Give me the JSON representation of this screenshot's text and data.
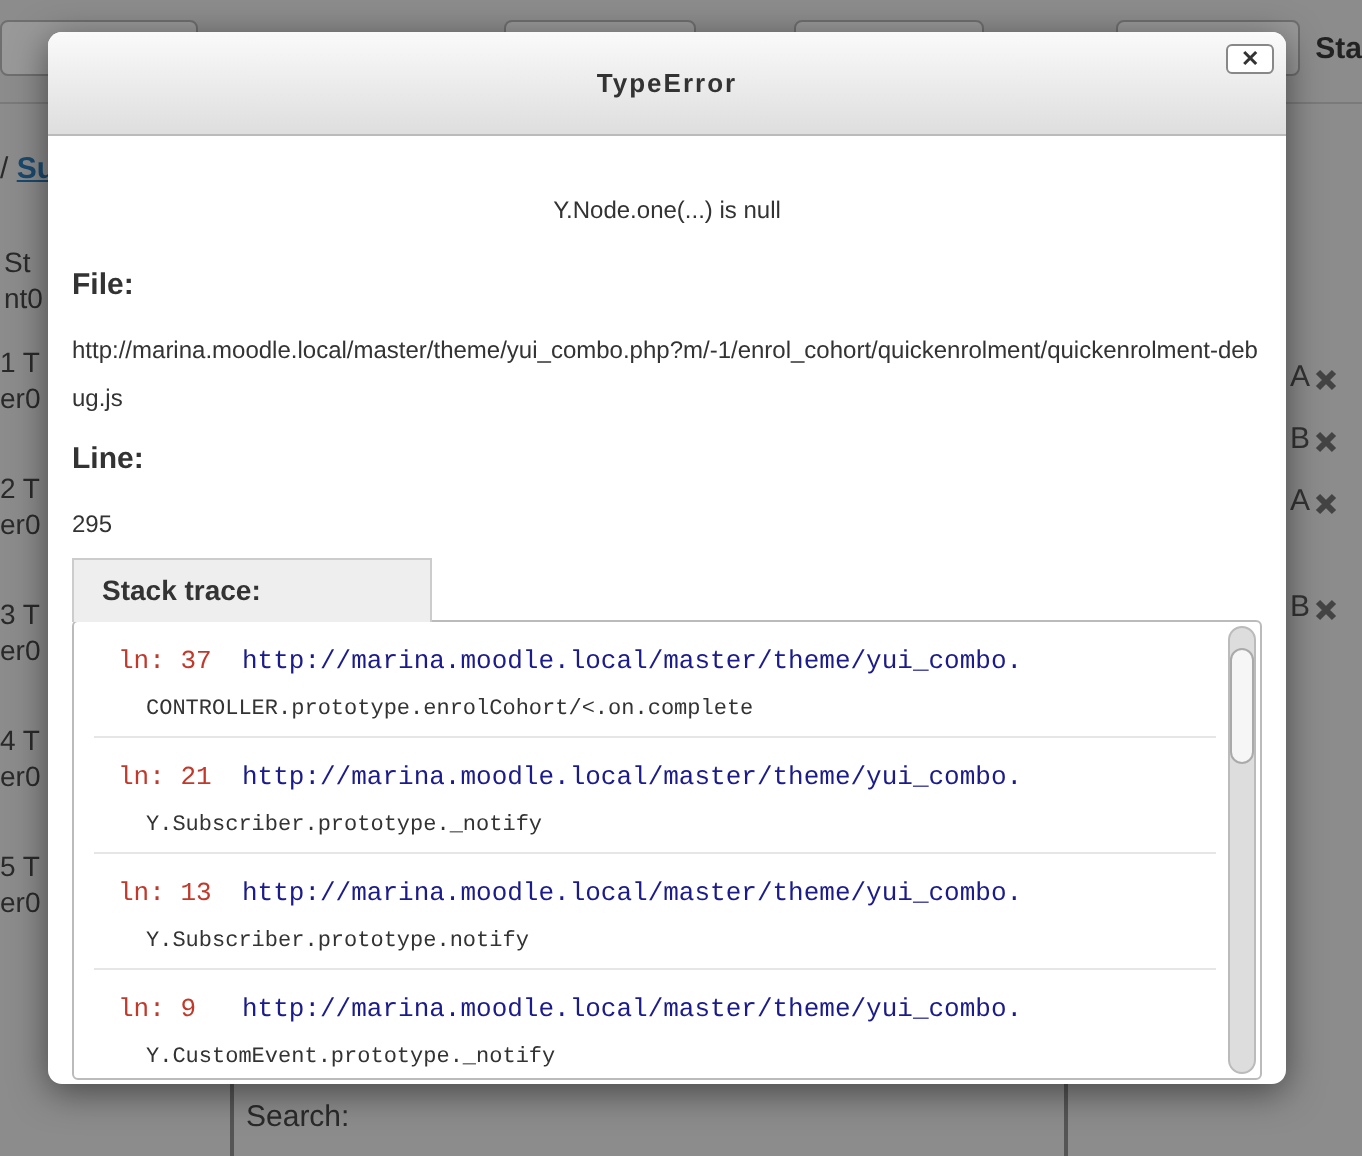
{
  "background": {
    "header_text": "Sta",
    "breadcrumb": {
      "separator": "/",
      "link": "Su"
    },
    "left_rows": [
      {
        "line1": "St",
        "line2": "nt0"
      },
      {
        "line1": "1 T",
        "line2": "er0"
      },
      {
        "line1": "2 T",
        "line2": "er0"
      },
      {
        "line1": "3 T",
        "line2": "er0"
      },
      {
        "line1": "4 T",
        "line2": "er0"
      },
      {
        "line1": "5 T",
        "line2": "er0"
      }
    ],
    "right_marks": [
      {
        "label": "A"
      },
      {
        "label": "B"
      },
      {
        "label": "A"
      },
      {
        "label": "B"
      }
    ],
    "search_label": "Search:"
  },
  "dialog": {
    "title": "TypeError",
    "close": "✕",
    "message": "Y.Node.one(...) is null",
    "file_label": "File:",
    "file": "http://marina.moodle.local/master/theme/yui_combo.php?m/-1/enrol_cohort/quickenrolment/quickenrolment-debug.js",
    "line_label": "Line:",
    "line": "295",
    "stack_label": "Stack trace:",
    "stack": [
      {
        "line": "ln: 37",
        "url": "http://marina.moodle.local/master/theme/yui_combo.",
        "function": "CONTROLLER.prototype.enrolCohort/<.on.complete"
      },
      {
        "line": "ln: 21",
        "url": "http://marina.moodle.local/master/theme/yui_combo.",
        "function": "Y.Subscriber.prototype._notify"
      },
      {
        "line": "ln: 13",
        "url": "http://marina.moodle.local/master/theme/yui_combo.",
        "function": "Y.Subscriber.prototype.notify"
      },
      {
        "line": "ln: 9",
        "url": "http://marina.moodle.local/master/theme/yui_combo.",
        "function": "Y.CustomEvent.prototype._notify"
      }
    ]
  }
}
